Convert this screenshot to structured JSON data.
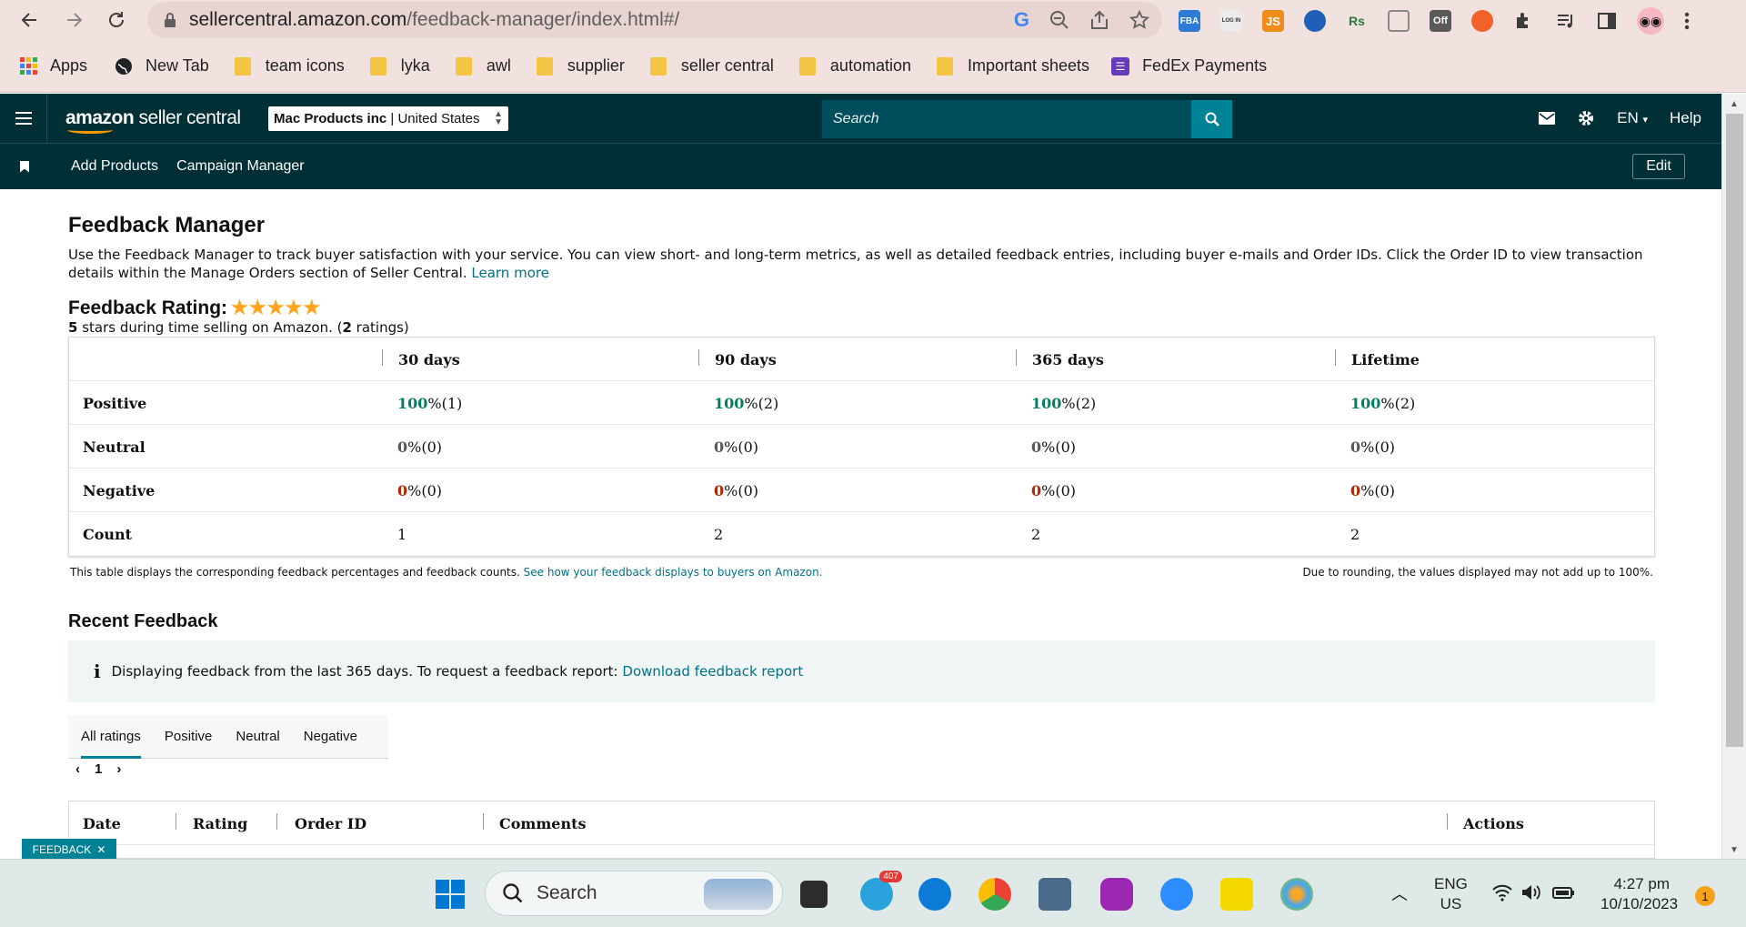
{
  "browser": {
    "url_host": "sellercentral.amazon.com",
    "url_path": "/feedback-manager/index.html#/",
    "extensions": [
      {
        "name": "fba",
        "label": "FBA",
        "color": "#2e7bd6"
      },
      {
        "name": "login",
        "label": "LOG IN",
        "color": "#6b6b6b"
      },
      {
        "name": "js",
        "label": "JS",
        "color": "#f08c1c"
      },
      {
        "name": "settings-blue",
        "label": "",
        "color": "#1f5fb7"
      },
      {
        "name": "rs",
        "label": "Rs",
        "color": "#2d7a3a"
      },
      {
        "name": "hex",
        "label": "",
        "color": "#888888"
      },
      {
        "name": "off",
        "label": "Off",
        "color": "#5a5a5a"
      },
      {
        "name": "firefox",
        "label": "",
        "color": "#f3612a"
      }
    ]
  },
  "bookmarks": [
    {
      "label": "Apps",
      "icon": "apps-grid-icon"
    },
    {
      "label": "New Tab",
      "icon": "globe-icon"
    },
    {
      "label": "team icons",
      "icon": "folder-icon"
    },
    {
      "label": "lyka",
      "icon": "folder-icon"
    },
    {
      "label": "awl",
      "icon": "folder-icon"
    },
    {
      "label": "supplier",
      "icon": "folder-icon"
    },
    {
      "label": "seller central",
      "icon": "folder-icon"
    },
    {
      "label": "automation",
      "icon": "folder-icon"
    },
    {
      "label": "Important sheets",
      "icon": "folder-icon"
    },
    {
      "label": "FedEx Payments",
      "icon": "list-icon"
    }
  ],
  "header": {
    "logo_brand": "amazon",
    "logo_product": "seller central",
    "account_name": "Mac Products inc",
    "account_region": "United States",
    "search_placeholder": "Search",
    "language": "EN",
    "help": "Help"
  },
  "nav": {
    "links": [
      "Add Products",
      "Campaign Manager"
    ],
    "edit": "Edit"
  },
  "page": {
    "title": "Feedback Manager",
    "description": "Use the Feedback Manager to track buyer satisfaction with your service. You can view short- and long-term metrics, as well as detailed feedback entries, including buyer e-mails and Order IDs. Click the Order ID to view transaction details within the Manage Orders section of Seller Central.",
    "learn_more": "Learn more",
    "rating_label": "Feedback Rating:",
    "stars": "★★★★★",
    "rating_stars_count": "5",
    "rating_sub_mid": " stars during time selling on Amazon. (",
    "rating_count": "2",
    "rating_sub_end": " ratings)"
  },
  "metrics": {
    "columns": [
      "30 days",
      "90 days",
      "365 days",
      "Lifetime"
    ],
    "rows": [
      {
        "label": "Positive",
        "values": [
          {
            "num": "100",
            "rest": " %(1)"
          },
          {
            "num": "100",
            "rest": " %(2)"
          },
          {
            "num": "100",
            "rest": " %(2)"
          },
          {
            "num": "100",
            "rest": " %(2)"
          }
        ]
      },
      {
        "label": "Neutral",
        "values": [
          {
            "num": "0",
            "rest": " %(0)"
          },
          {
            "num": "0",
            "rest": " %(0)"
          },
          {
            "num": "0",
            "rest": " %(0)"
          },
          {
            "num": "0",
            "rest": " %(0)"
          }
        ]
      },
      {
        "label": "Negative",
        "values": [
          {
            "num": "0",
            "rest": " %(0)"
          },
          {
            "num": "0",
            "rest": " %(0)"
          },
          {
            "num": "0",
            "rest": " %(0)"
          },
          {
            "num": "0",
            "rest": " %(0)"
          }
        ]
      },
      {
        "label": "Count",
        "values": [
          {
            "num": "",
            "rest": "1"
          },
          {
            "num": "",
            "rest": "2"
          },
          {
            "num": "",
            "rest": "2"
          },
          {
            "num": "",
            "rest": "2"
          }
        ]
      }
    ],
    "note_left": "This table displays the corresponding feedback percentages and feedback counts.",
    "note_link": "See how your feedback displays to buyers on Amazon.",
    "note_right": "Due to rounding, the values displayed may not add up to 100%."
  },
  "recent": {
    "title": "Recent Feedback",
    "info_text": "Displaying feedback from the last 365 days. To request a feedback report:",
    "info_link": "Download feedback report",
    "tabs": [
      "All ratings",
      "Positive",
      "Neutral",
      "Negative"
    ],
    "page": "1",
    "columns": [
      "Date",
      "Rating",
      "Order ID",
      "Comments",
      "Actions"
    ]
  },
  "feedback_tab": "FEEDBACK",
  "taskbar": {
    "search": "Search",
    "telegram_badge": "407",
    "lang_top": "ENG",
    "lang_bottom": "US",
    "time": "4:27 pm",
    "date": "10/10/2023",
    "notifications": "1"
  },
  "colors": {
    "header_bg": "#002f36",
    "search_btn": "#008296",
    "positive": "#067d62",
    "negative": "#b12704",
    "link": "#007185"
  }
}
